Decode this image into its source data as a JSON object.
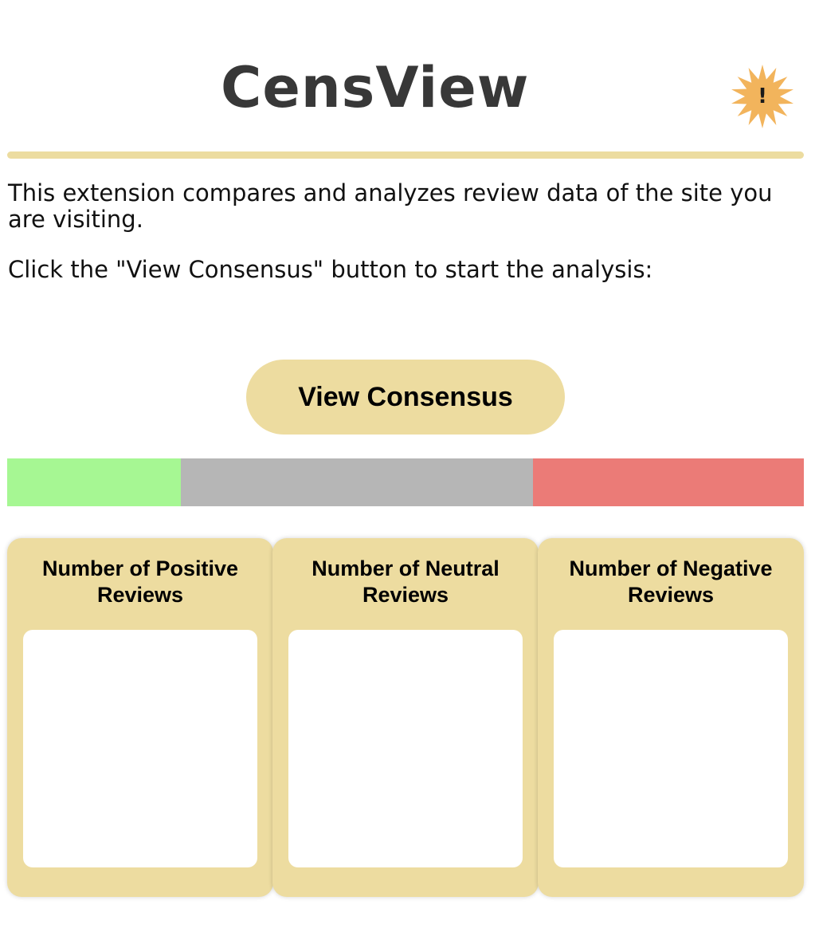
{
  "logo": {
    "text": "CensView",
    "badge_mark": "!",
    "badge_color": "#f2b45c",
    "text_color": "#383838"
  },
  "description": "This extension compares and analyzes review data of the site you are visiting.",
  "instruction": "Click the \"View Consensus\" button to start the analysis:",
  "button": {
    "label": "View Consensus"
  },
  "consensus": {
    "positive_fraction": 0.218,
    "neutral_fraction": 0.442,
    "negative_fraction": 0.34,
    "positive_color": "#a6f793",
    "neutral_color": "#b6b6b6",
    "negative_color": "#eb7b77"
  },
  "cards": [
    {
      "title": "Number of Positive Reviews",
      "value": ""
    },
    {
      "title": "Number of Neutral Reviews",
      "value": ""
    },
    {
      "title": "Number of Negative Reviews",
      "value": ""
    }
  ],
  "colors": {
    "accent": "#eddca0",
    "divider": "#ecdca0"
  }
}
